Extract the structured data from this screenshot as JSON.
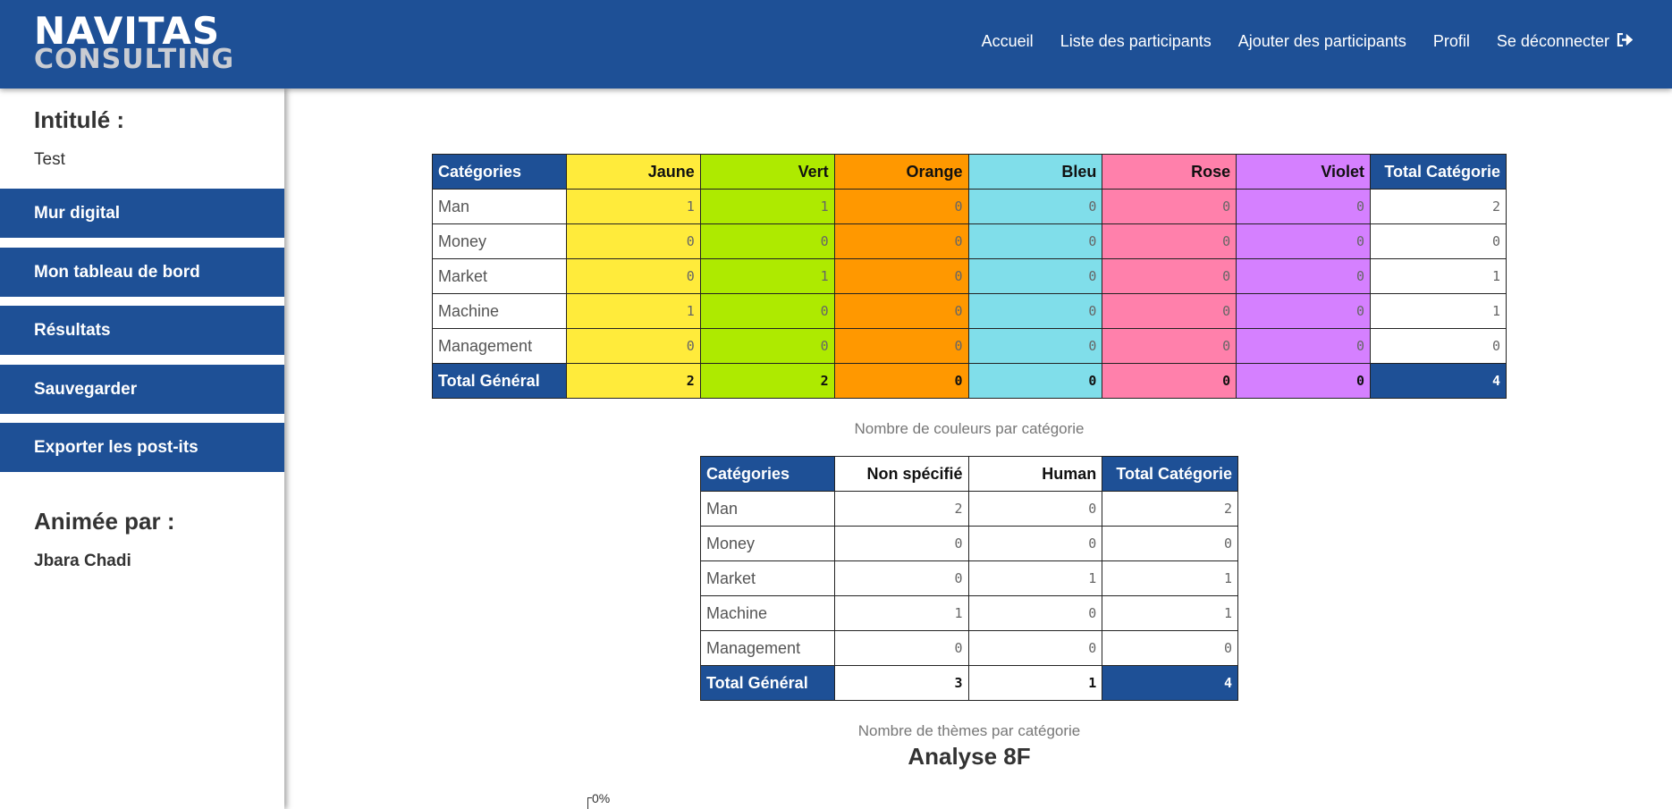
{
  "header": {
    "logo_top": "NAVITAS",
    "logo_bottom": "CONSULTING",
    "nav": [
      "Accueil",
      "Liste des participants",
      "Ajouter des participants",
      "Profil",
      "Se déconnecter"
    ],
    "logout_icon": "sign-out-icon"
  },
  "sidebar": {
    "intitule_label": "Intitulé :",
    "intitule_value": "Test",
    "buttons": [
      "Mur digital",
      "Mon tableau de bord",
      "Résultats",
      "Sauvegarder",
      "Exporter les post-its"
    ],
    "animee_label": "Animée par :",
    "animee_value": "Jbara Chadi"
  },
  "colors": {
    "primary": "#1e5096",
    "jaune": "#ffeb3b",
    "vert": "#aeea00",
    "orange": "#ff9800",
    "bleu": "#80deea",
    "rose": "#ff80ab",
    "violet": "#d580ff"
  },
  "table1": {
    "headers": [
      "Catégories",
      "Jaune",
      "Vert",
      "Orange",
      "Bleu",
      "Rose",
      "Violet",
      "Total Catégorie"
    ],
    "rows": [
      {
        "cat": "Man",
        "values": [
          "1",
          "1",
          "0",
          "0",
          "0",
          "0"
        ],
        "total": "2"
      },
      {
        "cat": "Money",
        "values": [
          "0",
          "0",
          "0",
          "0",
          "0",
          "0"
        ],
        "total": "0"
      },
      {
        "cat": "Market",
        "values": [
          "0",
          "1",
          "0",
          "0",
          "0",
          "0"
        ],
        "total": "1"
      },
      {
        "cat": "Machine",
        "values": [
          "1",
          "0",
          "0",
          "0",
          "0",
          "0"
        ],
        "total": "1"
      },
      {
        "cat": "Management",
        "values": [
          "0",
          "0",
          "0",
          "0",
          "0",
          "0"
        ],
        "total": "0"
      }
    ],
    "total_label": "Total Général",
    "totals": [
      "2",
      "2",
      "0",
      "0",
      "0",
      "0"
    ],
    "grand_total": "4",
    "caption": "Nombre de couleurs par catégorie"
  },
  "table2": {
    "headers": [
      "Catégories",
      "Non spécifié",
      "Human",
      "Total Catégorie"
    ],
    "rows": [
      {
        "cat": "Man",
        "values": [
          "2",
          "0"
        ],
        "total": "2"
      },
      {
        "cat": "Money",
        "values": [
          "0",
          "0"
        ],
        "total": "0"
      },
      {
        "cat": "Market",
        "values": [
          "0",
          "1"
        ],
        "total": "1"
      },
      {
        "cat": "Machine",
        "values": [
          "1",
          "0"
        ],
        "total": "1"
      },
      {
        "cat": "Management",
        "values": [
          "0",
          "0"
        ],
        "total": "0"
      }
    ],
    "total_label": "Total Général",
    "totals": [
      "3",
      "1"
    ],
    "grand_total": "4",
    "caption": "Nombre de thèmes par catégorie"
  },
  "analysis": {
    "title": "Analyse 8F",
    "first_tick": "0%"
  }
}
